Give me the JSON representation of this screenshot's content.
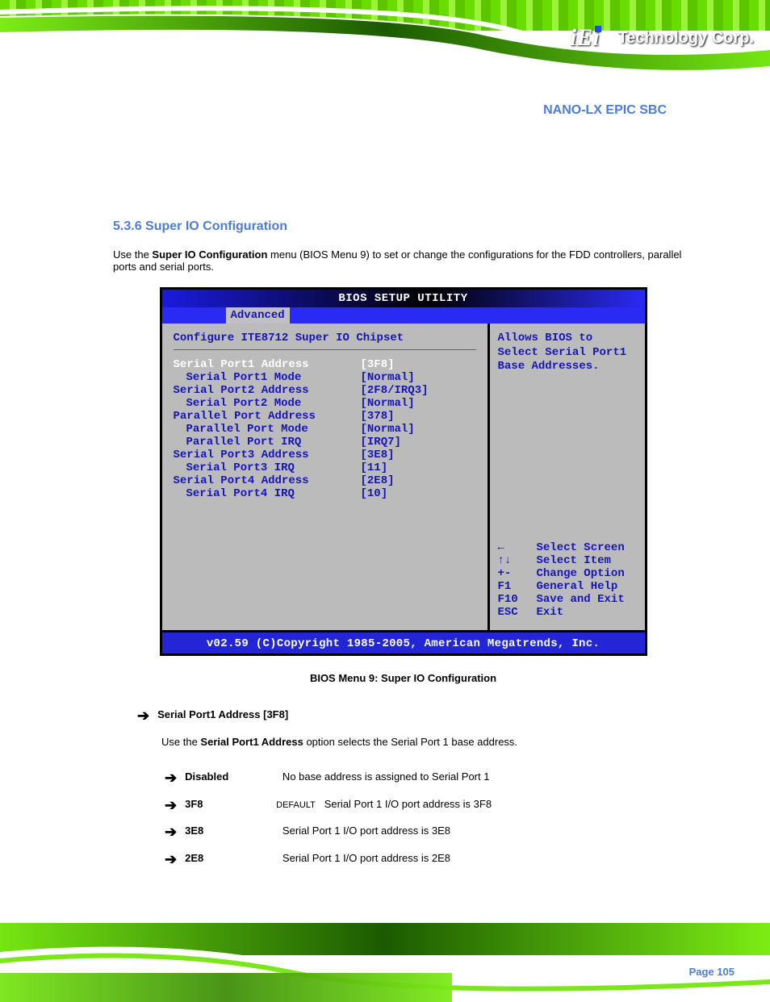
{
  "brand": {
    "logo_text": "iEi",
    "registered": "®",
    "corp_text": "Technology Corp."
  },
  "product_name": "NANO-LX EPIC SBC",
  "section": {
    "heading": "5.3.6 Super IO Configuration",
    "intro_pre": "Use the ",
    "intro_strong": "Super IO Configuration",
    "intro_post": " menu (BIOS Menu 9) to set or change the configurations for the FDD controllers, parallel ports and serial ports."
  },
  "bios": {
    "title": "BIOS SETUP UTILITY",
    "tab": "Advanced",
    "panel_title": "Configure ITE8712 Super IO Chipset",
    "rows": [
      {
        "label": "Serial Port1 Address",
        "value": "[3F8]",
        "selected": true,
        "indent": false
      },
      {
        "label": "Serial Port1 Mode",
        "value": "[Normal]",
        "selected": false,
        "indent": true
      },
      {
        "label": "Serial Port2 Address",
        "value": "[2F8/IRQ3]",
        "selected": false,
        "indent": false
      },
      {
        "label": "Serial Port2 Mode",
        "value": "[Normal]",
        "selected": false,
        "indent": true
      },
      {
        "label": "Parallel Port Address",
        "value": "[378]",
        "selected": false,
        "indent": false
      },
      {
        "label": "Parallel Port Mode",
        "value": "[Normal]",
        "selected": false,
        "indent": true
      },
      {
        "label": "Parallel Port IRQ",
        "value": "[IRQ7]",
        "selected": false,
        "indent": true
      },
      {
        "label": "Serial Port3 Address",
        "value": "[3E8]",
        "selected": false,
        "indent": false
      },
      {
        "label": "Serial Port3 IRQ",
        "value": "[11]",
        "selected": false,
        "indent": true
      },
      {
        "label": "Serial Port4 Address",
        "value": "[2E8]",
        "selected": false,
        "indent": false
      },
      {
        "label": "Serial Port4 IRQ",
        "value": "[10]",
        "selected": false,
        "indent": true
      }
    ],
    "help": "Allows BIOS to Select Serial Port1 Base Addresses.",
    "nav": [
      {
        "key": "←",
        "action": "Select Screen"
      },
      {
        "key": "↑↓",
        "action": "Select Item"
      },
      {
        "key": "+-",
        "action": "Change Option"
      },
      {
        "key": "F1",
        "action": "General Help"
      },
      {
        "key": "F10",
        "action": "Save and Exit"
      },
      {
        "key": "ESC",
        "action": "Exit"
      }
    ],
    "footer": "v02.59 (C)Copyright 1985-2005, American Megatrends, Inc."
  },
  "figure_caption": "BIOS Menu 9: Super IO Configuration",
  "item": {
    "heading": "Serial Port1 Address [3F8]",
    "desc_pre": "Use the ",
    "desc_strong": "Serial Port1 Address",
    "desc_post": " option selects the Serial Port 1 base address.",
    "options": [
      {
        "label": "Disabled",
        "default": "",
        "desc": "No base address is assigned to Serial Port 1"
      },
      {
        "label": "3F8",
        "default": "DEFAULT",
        "desc": "Serial Port 1 I/O port address is 3F8"
      },
      {
        "label": "3E8",
        "default": "",
        "desc": "Serial Port 1 I/O port address is 3E8"
      },
      {
        "label": "2E8",
        "default": "",
        "desc": "Serial Port 1 I/O port address is 2E8"
      }
    ]
  },
  "page_number": "Page 105"
}
